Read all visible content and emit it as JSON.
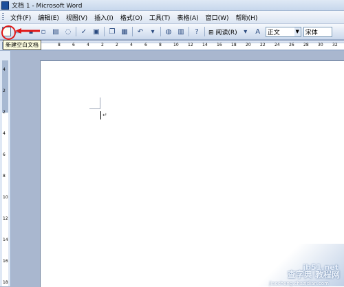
{
  "window": {
    "title": "文档 1 - Microsoft Word"
  },
  "menubar": {
    "items": [
      "文件(F)",
      "编辑(E)",
      "视图(V)",
      "插入(I)",
      "格式(O)",
      "工具(T)",
      "表格(A)",
      "窗口(W)",
      "帮助(H)"
    ]
  },
  "toolbar": {
    "read_label": "阅读(R)",
    "style_value": "正文",
    "font_value": "宋体",
    "tooltip": "新建空白文档",
    "buttons": [
      "new-blank-document",
      "open",
      "save",
      "permission",
      "print",
      "print-preview",
      "spelling",
      "research",
      "cut",
      "copy",
      "paste",
      "undo",
      "redo",
      "hyperlink",
      "tables-borders",
      "help",
      "read"
    ]
  },
  "ruler": {
    "h_labels": [
      "8",
      "6",
      "4",
      "2",
      "2",
      "4",
      "6",
      "8",
      "10",
      "12",
      "14",
      "16",
      "18",
      "20",
      "22",
      "24",
      "26",
      "28",
      "30",
      "32"
    ],
    "v_labels": [
      "4",
      "2",
      "2",
      "4",
      "6",
      "8",
      "10",
      "12",
      "14",
      "16",
      "18"
    ],
    "tab_selector": "L"
  },
  "document": {
    "paragraph_mark": "↵"
  },
  "watermark": {
    "site": "jb51.net",
    "name": "查字典 教程网",
    "url": "jiaocheng.chazidian.com"
  }
}
